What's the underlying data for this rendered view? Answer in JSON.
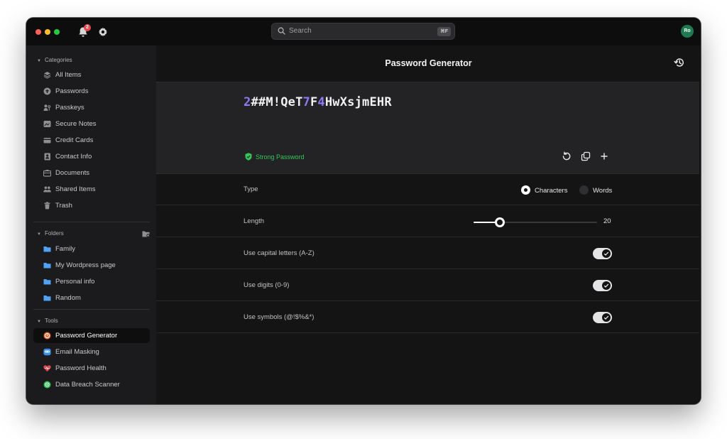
{
  "titlebar": {
    "notification_count": "2",
    "search": {
      "placeholder": "Search",
      "shortcut": "⌘F"
    },
    "avatar_initials": "Ro"
  },
  "sidebar": {
    "categories_label": "Categories",
    "categories": [
      {
        "label": "All Items",
        "icon": "layers-icon"
      },
      {
        "label": "Passwords",
        "icon": "key-icon"
      },
      {
        "label": "Passkeys",
        "icon": "passkey-icon"
      },
      {
        "label": "Secure Notes",
        "icon": "note-icon"
      },
      {
        "label": "Credit Cards",
        "icon": "credit-card-icon"
      },
      {
        "label": "Contact Info",
        "icon": "contact-icon"
      },
      {
        "label": "Documents",
        "icon": "document-icon"
      },
      {
        "label": "Shared Items",
        "icon": "people-icon"
      },
      {
        "label": "Trash",
        "icon": "trash-icon"
      }
    ],
    "folders_label": "Folders",
    "folders": [
      {
        "label": "Family",
        "icon": "folder-icon"
      },
      {
        "label": "My Wordpress page",
        "icon": "folder-icon"
      },
      {
        "label": "Personal info",
        "icon": "folder-icon"
      },
      {
        "label": "Random",
        "icon": "folder-icon"
      }
    ],
    "tools_label": "Tools",
    "tools": [
      {
        "label": "Password Generator",
        "icon": "generator-icon",
        "active": true
      },
      {
        "label": "Email Masking",
        "icon": "mask-icon"
      },
      {
        "label": "Password Health",
        "icon": "heart-icon"
      },
      {
        "label": "Data Breach Scanner",
        "icon": "radar-icon"
      }
    ]
  },
  "main": {
    "title": "Password Generator",
    "password": "2##M!QeT7F4HwXsjmEHR",
    "strength_label": "Strong Password",
    "type_label": "Type",
    "type_options": [
      "Characters",
      "Words"
    ],
    "type_selected": "Characters",
    "length_label": "Length",
    "length_value": "20",
    "length_fraction": 0.21,
    "options": [
      {
        "label": "Use capital letters (A-Z)",
        "enabled": true
      },
      {
        "label": "Use digits (0-9)",
        "enabled": true
      },
      {
        "label": "Use symbols (@!$%&*)",
        "enabled": true
      }
    ]
  },
  "colors": {
    "accent_digit": "#8b7cf6",
    "strength_green": "#34c759",
    "badge_red": "#e5484d"
  }
}
